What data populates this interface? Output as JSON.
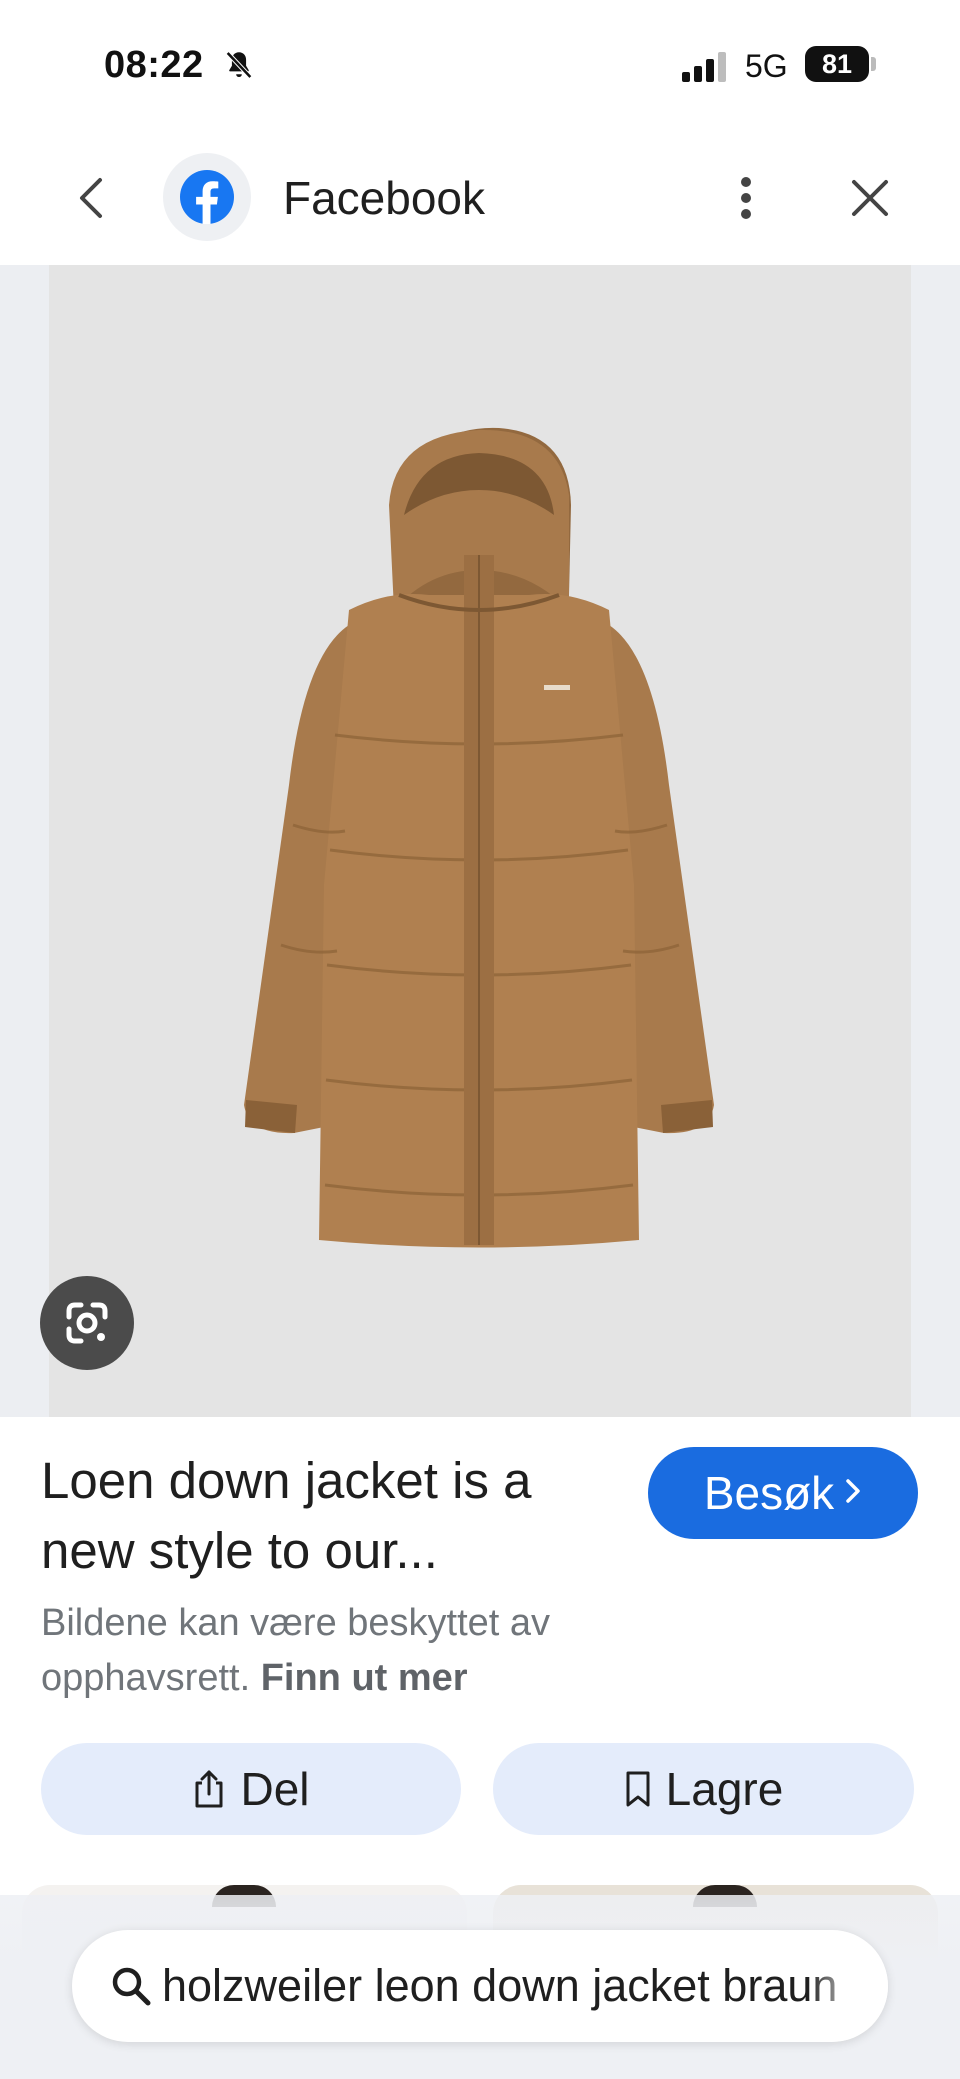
{
  "status_bar": {
    "time": "08:22",
    "network": "5G",
    "battery": "81",
    "icons": [
      "bell-muted-icon",
      "signal-icon",
      "battery-icon"
    ]
  },
  "app_bar": {
    "site_name": "Facebook",
    "icons": [
      "back-chevron-icon",
      "facebook-logo-icon",
      "more-vert-icon",
      "close-icon"
    ],
    "brand_color": "#1877f2"
  },
  "image": {
    "lens_icon": "google-lens-icon",
    "jacket_color": "#a87a4c",
    "background": "#e4e4e4"
  },
  "result": {
    "title": "Loen down jacket is a new style to our...",
    "visit_label": "Besøk",
    "visit_color": "#1a6ce0",
    "copyright_text": "Bildene kan være beskyttet av opphavsrett.",
    "learn_more": "Finn ut mer"
  },
  "actions": {
    "share_label": "Del",
    "save_label": "Lagre"
  },
  "search": {
    "query": "holzweiler leon down jacket braun"
  }
}
